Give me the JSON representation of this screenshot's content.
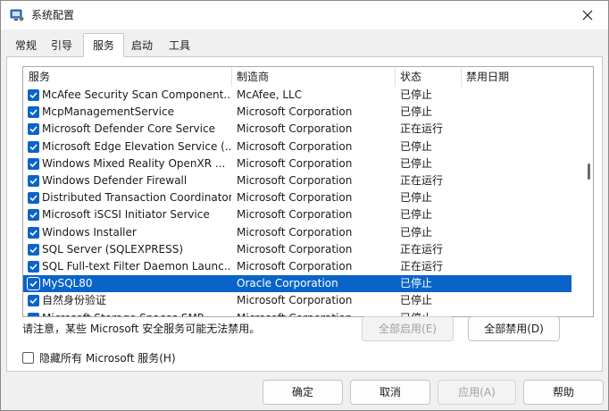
{
  "window": {
    "title": "系统配置"
  },
  "tabs": [
    "常规",
    "引导",
    "服务",
    "启动",
    "工具"
  ],
  "active_tab": "服务",
  "columns": {
    "service": "服务",
    "manufacturer": "制造商",
    "status": "状态",
    "disabled_date": "禁用日期"
  },
  "services": [
    {
      "name": "McAfee Security Scan Component...",
      "manufacturer": "McAfee, LLC",
      "status": "已停止",
      "checked": true
    },
    {
      "name": "McpManagementService",
      "manufacturer": "Microsoft Corporation",
      "status": "已停止",
      "checked": true
    },
    {
      "name": "Microsoft Defender Core Service",
      "manufacturer": "Microsoft Corporation",
      "status": "正在运行",
      "checked": true
    },
    {
      "name": "Microsoft Edge Elevation Service (...",
      "manufacturer": "Microsoft Corporation",
      "status": "已停止",
      "checked": true
    },
    {
      "name": "Windows Mixed Reality OpenXR ...",
      "manufacturer": "Microsoft Corporation",
      "status": "已停止",
      "checked": true
    },
    {
      "name": "Windows Defender Firewall",
      "manufacturer": "Microsoft Corporation",
      "status": "正在运行",
      "checked": true
    },
    {
      "name": "Distributed Transaction Coordinator",
      "manufacturer": "Microsoft Corporation",
      "status": "已停止",
      "checked": true
    },
    {
      "name": "Microsoft iSCSI Initiator Service",
      "manufacturer": "Microsoft Corporation",
      "status": "已停止",
      "checked": true
    },
    {
      "name": "Windows Installer",
      "manufacturer": "Microsoft Corporation",
      "status": "已停止",
      "checked": true
    },
    {
      "name": "SQL Server (SQLEXPRESS)",
      "manufacturer": "Microsoft Corporation",
      "status": "正在运行",
      "checked": true
    },
    {
      "name": "SQL Full-text Filter Daemon Launc...",
      "manufacturer": "Microsoft Corporation",
      "status": "正在运行",
      "checked": true
    },
    {
      "name": "MySQL80",
      "manufacturer": "Oracle Corporation",
      "status": "已停止",
      "checked": true,
      "selected": true
    },
    {
      "name": "自然身份验证",
      "manufacturer": "Microsoft Corporation",
      "status": "已停止",
      "checked": true
    },
    {
      "name": "Microsoft Storage Spaces SMP",
      "manufacturer": "Microsoft Corporation",
      "status": "已停止",
      "checked": true
    }
  ],
  "note": "请注意，某些 Microsoft 安全服务可能无法禁用。",
  "buttons": {
    "enable_all": "全部启用(E)",
    "disable_all": "全部禁用(D)",
    "ok": "确定",
    "cancel": "取消",
    "apply": "应用(A)",
    "help": "帮助"
  },
  "hide_ms_label": "隐藏所有 Microsoft 服务(H)",
  "colors": {
    "accent": "#0a64c8",
    "panel": "#ffffff",
    "window_bg": "#f0f0f0"
  }
}
